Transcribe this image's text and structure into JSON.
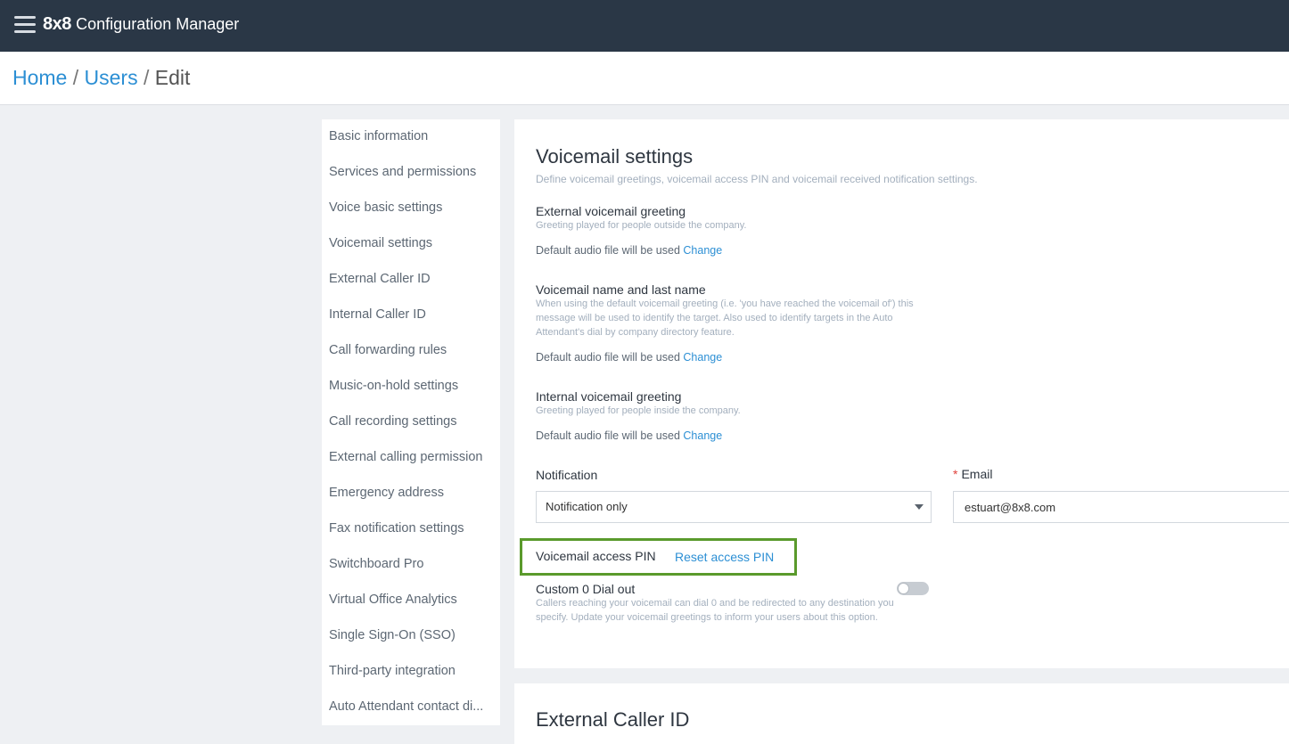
{
  "header": {
    "menu_icon": "hamburger-menu-icon",
    "logo_text": "8x8",
    "app_title": "Configuration Manager"
  },
  "breadcrumb": {
    "home": "Home",
    "users": "Users",
    "current": "Edit",
    "separator": "/"
  },
  "sidebar": {
    "items": [
      {
        "label": "Basic information"
      },
      {
        "label": "Services and permissions"
      },
      {
        "label": "Voice basic settings"
      },
      {
        "label": "Voicemail settings"
      },
      {
        "label": "External Caller ID"
      },
      {
        "label": "Internal Caller ID"
      },
      {
        "label": "Call forwarding rules"
      },
      {
        "label": "Music-on-hold settings"
      },
      {
        "label": "Call recording settings"
      },
      {
        "label": "External calling permission"
      },
      {
        "label": "Emergency address"
      },
      {
        "label": "Fax notification settings"
      },
      {
        "label": "Switchboard Pro"
      },
      {
        "label": "Virtual Office Analytics"
      },
      {
        "label": "Single Sign-On (SSO)"
      },
      {
        "label": "Third-party integration"
      },
      {
        "label": "Auto Attendant contact di..."
      }
    ]
  },
  "voicemail": {
    "title": "Voicemail settings",
    "subtitle": "Define voicemail greetings, voicemail access PIN and voicemail received notification settings.",
    "external_greeting": {
      "label": "External voicemail greeting",
      "help": "Greeting played for people outside the company.",
      "status": "Default audio file will be used",
      "change": "Change"
    },
    "name_greeting": {
      "label": "Voicemail name and last name",
      "help": "When using the default voicemail greeting (i.e. 'you have reached the voicemail of') this message will be used to identify the target. Also used to identify targets in the Auto Attendant's dial by company directory feature.",
      "status": "Default audio file will be used",
      "change": "Change"
    },
    "internal_greeting": {
      "label": "Internal voicemail greeting",
      "help": "Greeting played for people inside the company.",
      "status": "Default audio file will be used",
      "change": "Change"
    },
    "notification": {
      "label": "Notification",
      "value": "Notification only"
    },
    "email": {
      "required_mark": "*",
      "label": "Email",
      "value": "estuart@8x8.com"
    },
    "access_pin": {
      "label": "Voicemail access PIN",
      "reset": "Reset access PIN"
    },
    "dial_out": {
      "label": "Custom 0 Dial out",
      "help": "Callers reaching your voicemail can dial 0 and be redirected to any destination you specify. Update your voicemail greetings to inform your users about this option.",
      "enabled": false
    }
  },
  "external_caller_id": {
    "title": "External Caller ID"
  },
  "colors": {
    "topbar": "#2a3746",
    "link": "#2c8fd4",
    "highlight": "#5a9a2c"
  }
}
